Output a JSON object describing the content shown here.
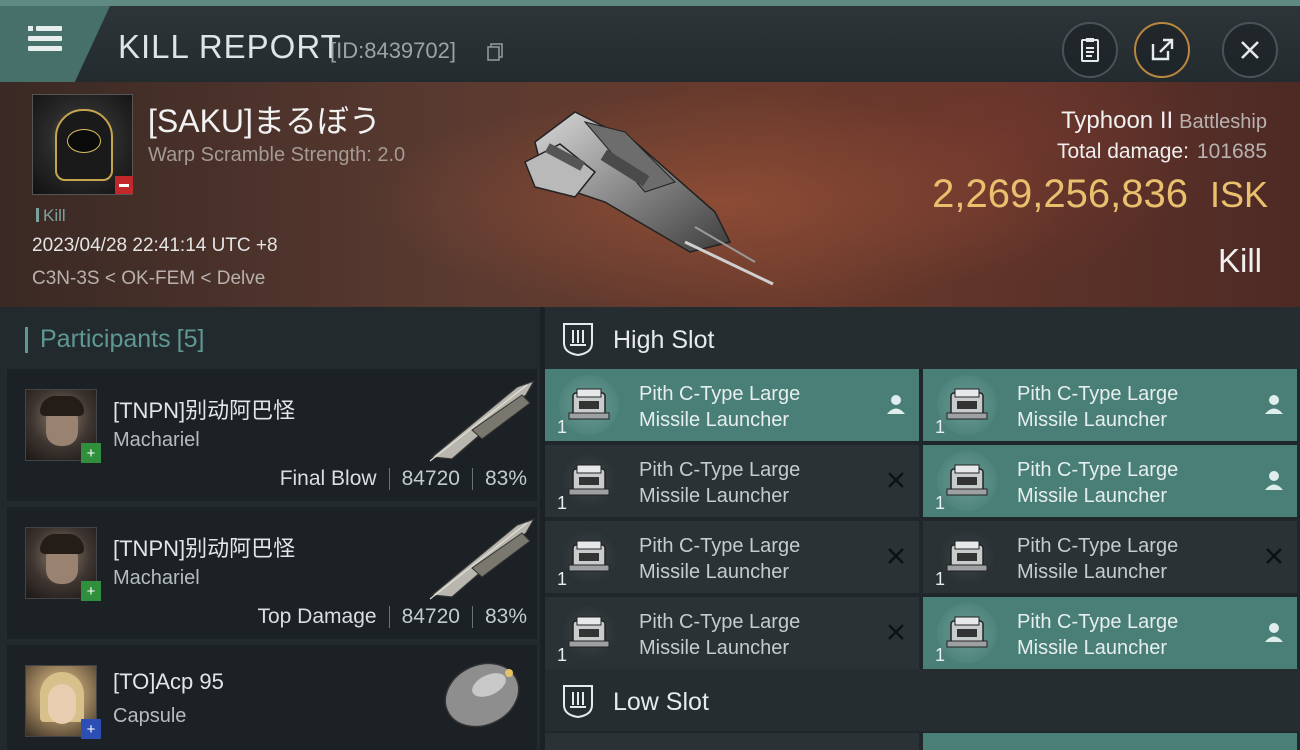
{
  "header": {
    "title": "KILL REPORT",
    "report_id": "[ID:8439702]",
    "icons": [
      "menu-icon",
      "copy-icon",
      "clipboard-icon",
      "share-icon",
      "close-icon"
    ]
  },
  "victim": {
    "name": "[SAKU]まるぼう",
    "warp_scramble": "Warp Scramble Strength: 2.0",
    "tag": "Kill",
    "time": "2023/04/28 22:41:14 UTC +8",
    "location": "C3N-3S < OK-FEM < Delve",
    "ship_name": "Typhoon II",
    "ship_class": "Battleship",
    "total_damage_label": "Total damage:",
    "total_damage": "101685",
    "isk_value": "2,269,256,836",
    "isk_unit": "ISK",
    "result": "Kill"
  },
  "participants": {
    "title": "Participants",
    "count": "[5]",
    "rows": [
      {
        "name": "[TNPN]别动阿巴怪",
        "ship": "Machariel",
        "role": "Final Blow",
        "damage": "84720",
        "percent": "83%",
        "badge": "+"
      },
      {
        "name": "[TNPN]别动阿巴怪",
        "ship": "Machariel",
        "role": "Top Damage",
        "damage": "84720",
        "percent": "83%",
        "badge": "+"
      },
      {
        "name": "[TO]Acp 95",
        "ship": "Capsule",
        "badge": "+"
      }
    ]
  },
  "fitting": {
    "high_slot_label": "High Slot",
    "low_slot_label": "Low Slot",
    "high_modules": [
      {
        "line1": "Pith C-Type Large",
        "line2": "Missile Launcher",
        "qty": "1",
        "status": "pilot"
      },
      {
        "line1": "Pith C-Type Large",
        "line2": "Missile Launcher",
        "qty": "1",
        "status": "pilot"
      },
      {
        "line1": "Pith C-Type Large",
        "line2": "Missile Launcher",
        "qty": "1",
        "status": "destroyed"
      },
      {
        "line1": "Pith C-Type Large",
        "line2": "Missile Launcher",
        "qty": "1",
        "status": "pilot"
      },
      {
        "line1": "Pith C-Type Large",
        "line2": "Missile Launcher",
        "qty": "1",
        "status": "destroyed"
      },
      {
        "line1": "Pith C-Type Large",
        "line2": "Missile Launcher",
        "qty": "1",
        "status": "destroyed"
      },
      {
        "line1": "Pith C-Type Large",
        "line2": "Missile Launcher",
        "qty": "1",
        "status": "destroyed"
      },
      {
        "line1": "Pith C-Type Large",
        "line2": "Missile Launcher",
        "qty": "1",
        "status": "pilot"
      }
    ]
  },
  "colors": {
    "accent": "#4a7f78",
    "isk_gold": "#e9c06d",
    "participant_title": "#5f9893"
  }
}
